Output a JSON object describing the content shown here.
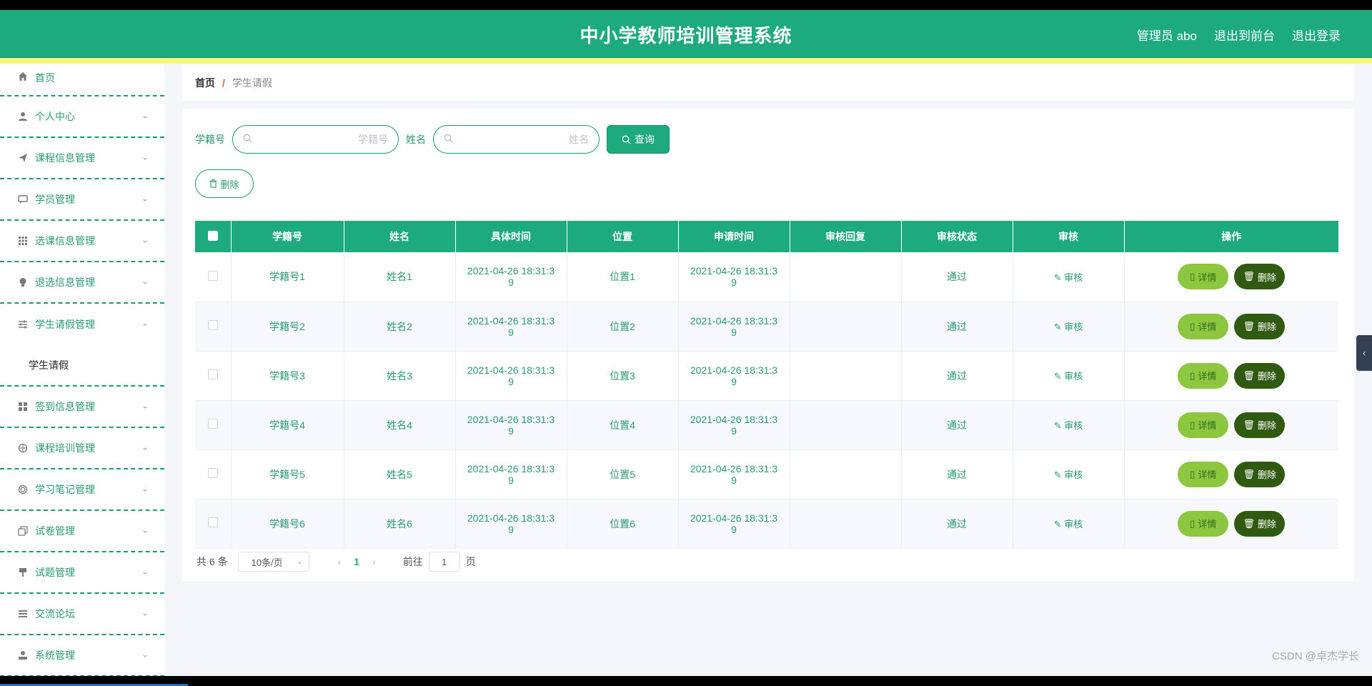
{
  "header": {
    "title": "中小学教师培训管理系统",
    "admin": "管理员 abo",
    "to_front": "退出到前台",
    "logout": "退出登录"
  },
  "sidebar": {
    "items": [
      {
        "label": "首页",
        "icon": "home-icon"
      },
      {
        "label": "个人中心",
        "icon": "user-icon"
      },
      {
        "label": "课程信息管理",
        "icon": "send-icon"
      },
      {
        "label": "学员管理",
        "icon": "chat-icon"
      },
      {
        "label": "选课信息管理",
        "icon": "grid-icon"
      },
      {
        "label": "退选信息管理",
        "icon": "bulb-icon"
      },
      {
        "label": "学生请假管理",
        "icon": "sliders-icon"
      },
      {
        "label": "签到信息管理",
        "icon": "apps-icon"
      },
      {
        "label": "课程培训管理",
        "icon": "target-icon"
      },
      {
        "label": "学习笔记管理",
        "icon": "circle-icon"
      },
      {
        "label": "试卷管理",
        "icon": "copy-icon"
      },
      {
        "label": "试题管理",
        "icon": "brush-icon"
      },
      {
        "label": "交流论坛",
        "icon": "list-icon"
      },
      {
        "label": "系统管理",
        "icon": "person-icon"
      }
    ],
    "submenu_active": "学生请假"
  },
  "breadcrumb": {
    "home": "首页",
    "separator": "/",
    "current": "学生请假"
  },
  "search": {
    "label1": "学籍号",
    "placeholder1": "学籍号",
    "label2": "姓名",
    "placeholder2": "姓名",
    "query_label": "查询"
  },
  "toolbar": {
    "delete_label": "删除"
  },
  "table": {
    "headers": [
      "学籍号",
      "姓名",
      "具体时间",
      "位置",
      "申请时间",
      "审核回复",
      "审核状态",
      "审核",
      "操作"
    ],
    "audit_label": "审核",
    "detail_label": "详情",
    "delete_label": "删除",
    "rows": [
      {
        "id": "学籍号1",
        "name": "姓名1",
        "time1": "2021-04-26 18:31:3",
        "time2": "9",
        "loc": "位置1",
        "apply1": "2021-04-26 18:31:3",
        "apply2": "9",
        "reply": "",
        "status": "通过"
      },
      {
        "id": "学籍号2",
        "name": "姓名2",
        "time1": "2021-04-26 18:31:3",
        "time2": "9",
        "loc": "位置2",
        "apply1": "2021-04-26 18:31:3",
        "apply2": "9",
        "reply": "",
        "status": "通过"
      },
      {
        "id": "学籍号3",
        "name": "姓名3",
        "time1": "2021-04-26 18:31:3",
        "time2": "9",
        "loc": "位置3",
        "apply1": "2021-04-26 18:31:3",
        "apply2": "9",
        "reply": "",
        "status": "通过"
      },
      {
        "id": "学籍号4",
        "name": "姓名4",
        "time1": "2021-04-26 18:31:3",
        "time2": "9",
        "loc": "位置4",
        "apply1": "2021-04-26 18:31:3",
        "apply2": "9",
        "reply": "",
        "status": "通过"
      },
      {
        "id": "学籍号5",
        "name": "姓名5",
        "time1": "2021-04-26 18:31:3",
        "time2": "9",
        "loc": "位置5",
        "apply1": "2021-04-26 18:31:3",
        "apply2": "9",
        "reply": "",
        "status": "通过"
      },
      {
        "id": "学籍号6",
        "name": "姓名6",
        "time1": "2021-04-26 18:31:3",
        "time2": "9",
        "loc": "位置6",
        "apply1": "2021-04-26 18:31:3",
        "apply2": "9",
        "reply": "",
        "status": "通过"
      }
    ]
  },
  "pagination": {
    "total": "共 6 条",
    "page_size": "10条/页",
    "current_page": "1",
    "goto_prefix": "前往",
    "goto_value": "1",
    "goto_suffix": "页"
  },
  "watermark": "CSDN @卓杰学长",
  "colors": {
    "primary": "#1daa7c",
    "stripe": "#f7f77e",
    "detail_btn": "#8dc63f",
    "delete_btn": "#2f5a0f"
  }
}
